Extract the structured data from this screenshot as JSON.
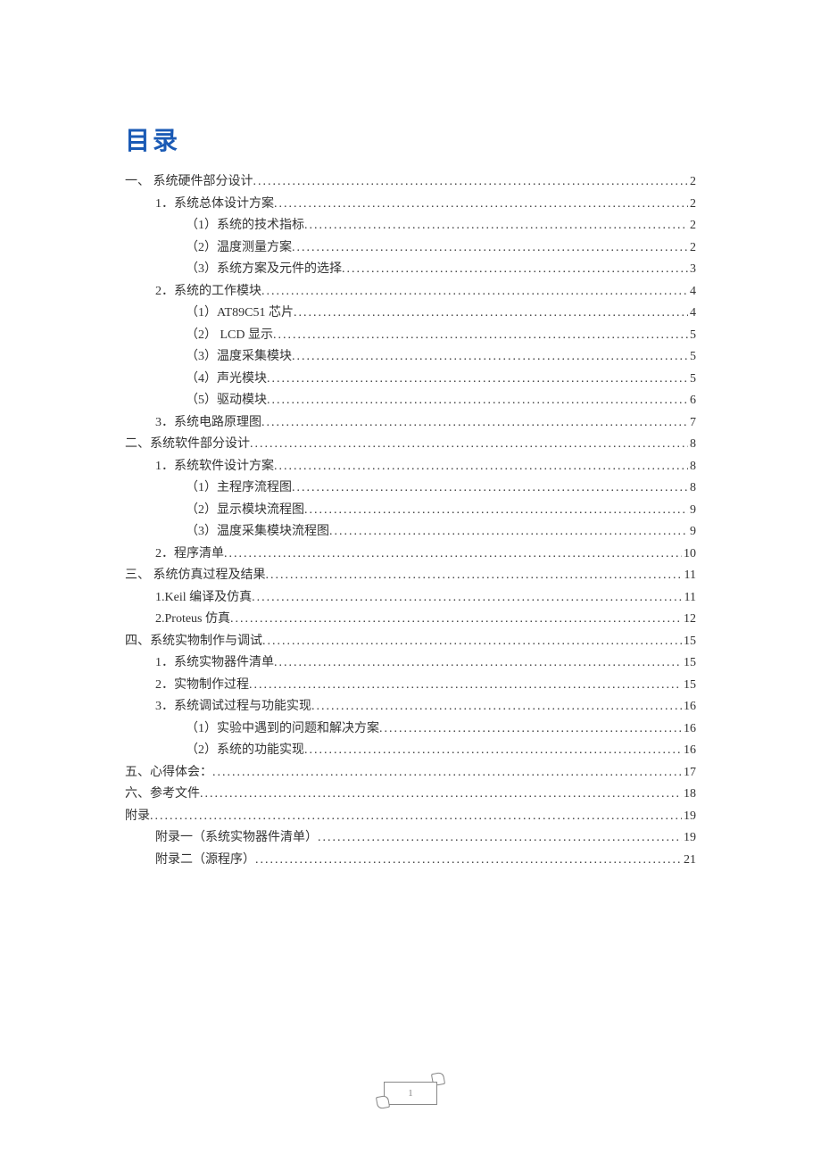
{
  "title": "目录",
  "footer_page": "1",
  "toc": [
    {
      "indent": 0,
      "text": "一、    系统硬件部分设计",
      "page": "2"
    },
    {
      "indent": 1,
      "text": "1．系统总体设计方案",
      "page": "2"
    },
    {
      "indent": 2,
      "text": "（1）系统的技术指标",
      "page": "2"
    },
    {
      "indent": 2,
      "text": "（2）温度测量方案",
      "page": "2"
    },
    {
      "indent": 2,
      "text": "（3）系统方案及元件的选择",
      "page": "3"
    },
    {
      "indent": 1,
      "text": "2．系统的工作模块",
      "page": "4"
    },
    {
      "indent": 2,
      "text": "（1）AT89C51 芯片",
      "page": "4"
    },
    {
      "indent": 2,
      "text": "（2） LCD 显示",
      "page": "5"
    },
    {
      "indent": 2,
      "text": "（3）温度采集模块",
      "page": "5"
    },
    {
      "indent": 2,
      "text": "（4）声光模块",
      "page": "5"
    },
    {
      "indent": 2,
      "text": "（5）驱动模块",
      "page": "6"
    },
    {
      "indent": 1,
      "text": "3．系统电路原理图",
      "page": "7"
    },
    {
      "indent": 0,
      "text": "二、系统软件部分设计",
      "page": "8"
    },
    {
      "indent": 1,
      "text": "1．系统软件设计方案",
      "page": "8"
    },
    {
      "indent": 2,
      "text": "（1）主程序流程图",
      "page": "8"
    },
    {
      "indent": 2,
      "text": "（2）显示模块流程图",
      "page": "9"
    },
    {
      "indent": 2,
      "text": "（3）温度采集模块流程图",
      "page": "9"
    },
    {
      "indent": 1,
      "text": "2．程序清单",
      "page": "10"
    },
    {
      "indent": 0,
      "text": "三、    系统仿真过程及结果",
      "page": "11"
    },
    {
      "indent": 1,
      "text": "1.Keil 编译及仿真",
      "page": "11"
    },
    {
      "indent": 1,
      "text": "2.Proteus 仿真",
      "page": "12"
    },
    {
      "indent": 0,
      "text": "四、系统实物制作与调试",
      "page": "15"
    },
    {
      "indent": 1,
      "text": "1．系统实物器件清单",
      "page": "15"
    },
    {
      "indent": 1,
      "text": "2．实物制作过程",
      "page": "15"
    },
    {
      "indent": 1,
      "text": "3．系统调试过程与功能实现",
      "page": "16"
    },
    {
      "indent": 2,
      "text": "（1）实验中遇到的问题和解决方案",
      "page": "16"
    },
    {
      "indent": 2,
      "text": "（2）系统的功能实现",
      "page": "16"
    },
    {
      "indent": 0,
      "text": "五、心得体会：",
      "page": "17"
    },
    {
      "indent": 0,
      "text": "六、参考文件",
      "page": "18"
    },
    {
      "indent": 0,
      "text": "附录",
      "page": "19"
    },
    {
      "indent": 1,
      "text": "附录一（系统实物器件清单）",
      "page": "19"
    },
    {
      "indent": 1,
      "text": "附录二（源程序）",
      "page": "21"
    }
  ]
}
